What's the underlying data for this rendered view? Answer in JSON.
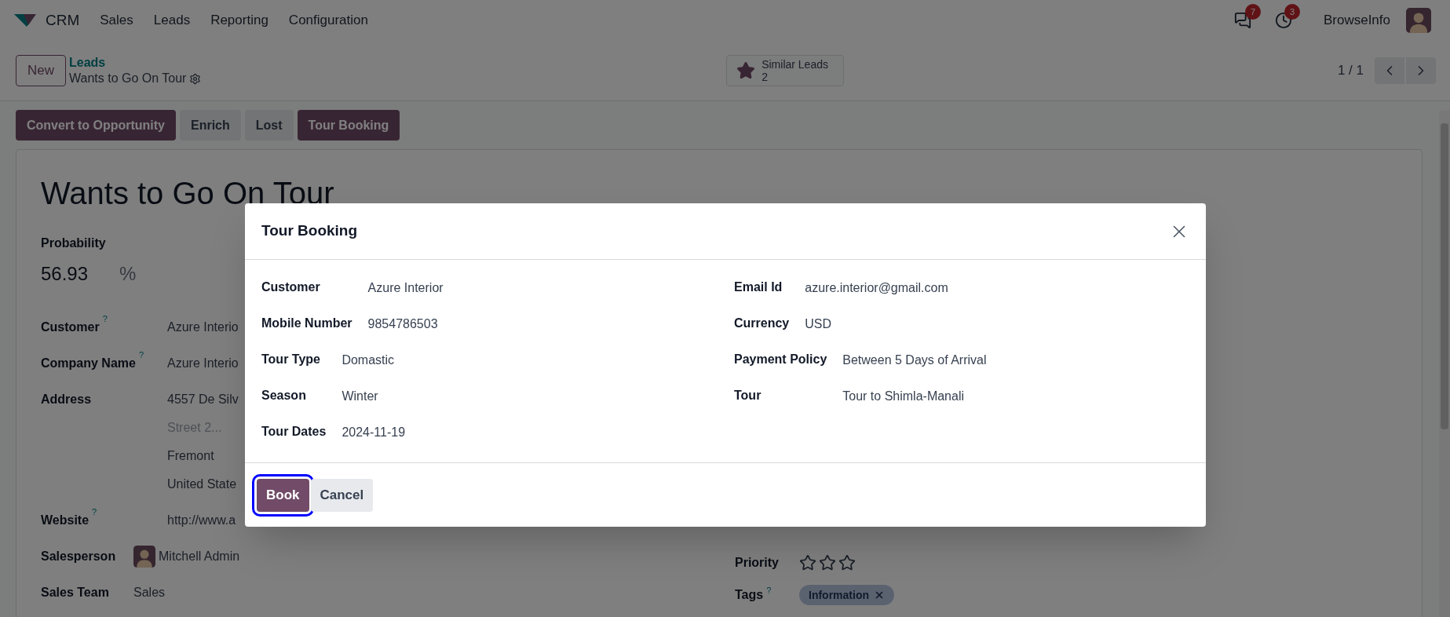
{
  "navbar": {
    "app_name": "CRM",
    "menu": [
      "Sales",
      "Leads",
      "Reporting",
      "Configuration"
    ],
    "messages_count": "7",
    "activities_count": "3",
    "company": "BrowseInfo"
  },
  "control_panel": {
    "new_button": "New",
    "breadcrumb": "Leads",
    "record": "Wants to Go On Tour",
    "smart_button": {
      "label": "Similar Leads",
      "count": "2"
    },
    "pager": "1 / 1"
  },
  "actions": [
    {
      "label": "Convert to Opportunity",
      "kind": "primary"
    },
    {
      "label": "Enrich",
      "kind": "secondary"
    },
    {
      "label": "Lost",
      "kind": "secondary"
    },
    {
      "label": "Tour Booking",
      "kind": "primary"
    }
  ],
  "form": {
    "title": "Wants to Go On Tour",
    "probability": {
      "label": "Probability",
      "value": "56.93",
      "unit": "%"
    },
    "groups": [
      [
        {
          "label": "Customer",
          "help": "?",
          "lines": [
            {
              "text": "Azure Interio",
              "placeholder": false
            }
          ]
        },
        {
          "label": "Company Name",
          "help": "?",
          "lines": [
            {
              "text": "Azure Interio",
              "placeholder": false
            }
          ]
        },
        {
          "label": "Address",
          "lines": [
            {
              "text": "4557 De Silv",
              "placeholder": false
            },
            {
              "text": "Street 2...",
              "placeholder": true
            },
            {
              "text": "Fremont",
              "placeholder": false
            },
            {
              "text": "United State",
              "placeholder": false
            }
          ]
        },
        {
          "label": "Website",
          "help": "?",
          "lines": [
            {
              "text": "http://www.a",
              "placeholder": false
            }
          ]
        }
      ],
      [
        {
          "label": "Salesperson",
          "kind": "user",
          "lines": [
            {
              "text": "Mitchell Admin",
              "placeholder": false
            }
          ]
        },
        {
          "label": "Sales Team",
          "lines": [
            {
              "text": "Sales",
              "placeholder": false
            }
          ]
        }
      ]
    ],
    "priority": {
      "label": "Priority",
      "stars": 0
    },
    "tags": {
      "label": "Tags",
      "help": "?",
      "items": [
        {
          "label": "Information"
        }
      ]
    }
  },
  "dialog": {
    "title": "Tour Booking",
    "left": [
      [
        {
          "label": "Customer",
          "value": "Azure Interior"
        },
        {
          "label": "Mobile Number",
          "value": "9854786503"
        }
      ],
      [
        {
          "label": "Tour Type",
          "value": "Domastic"
        },
        {
          "label": "Season",
          "value": "Winter"
        },
        {
          "label": "Tour Dates",
          "value": "2024-11-19"
        }
      ]
    ],
    "right": [
      [
        {
          "label": "Email Id",
          "value": "azure.interior@gmail.com"
        },
        {
          "label": "Currency",
          "value": "USD"
        }
      ],
      [
        {
          "label": "Payment Policy",
          "value": "Between 5 Days of Arrival"
        },
        {
          "label": "Tour",
          "value": "Tour to Shimla-Manali"
        }
      ]
    ],
    "buttons": [
      {
        "label": "Book",
        "kind": "primary",
        "focused": true
      },
      {
        "label": "Cancel",
        "kind": "secondary",
        "focused": false
      }
    ]
  }
}
